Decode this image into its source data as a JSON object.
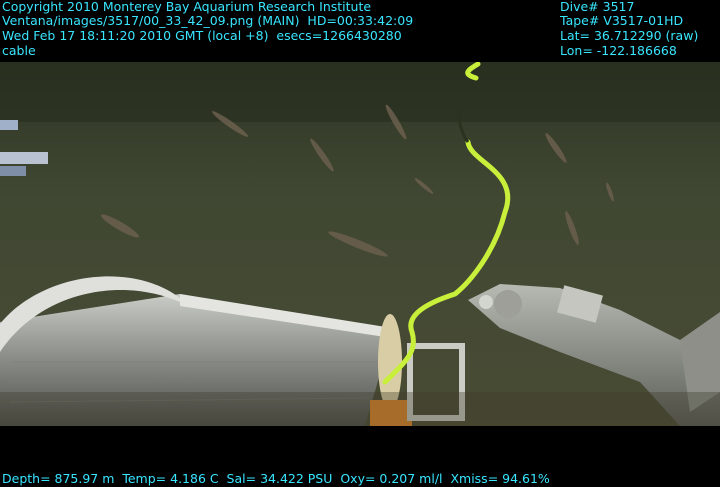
{
  "overlay": {
    "left_lines": [
      "Copyright 2010 Monterey Bay Aquarium Research Institute",
      "Ventana/images/3517/00_33_42_09.png (MAIN)  HD=00:33:42:09",
      "Wed Feb 17 18:11:20 2010 GMT (local +8)  esecs=1266430280",
      "cable"
    ],
    "right_lines": [
      "Dive# 3517",
      "Tape# V3517-01HD",
      "Lat= 36.712290 (raw)",
      "Lon= -122.186668"
    ],
    "bottom_line": "Depth= 875.97 m  Temp= 4.186 C  Sal= 34.422 PSU  Oxy= 0.207 ml/l  Xmiss= 94.61%"
  },
  "colors": {
    "overlay_text": "#39e6ff",
    "seafloor": "#3c4430",
    "cable": "#c8f03a",
    "spool": "#9a9c98"
  }
}
